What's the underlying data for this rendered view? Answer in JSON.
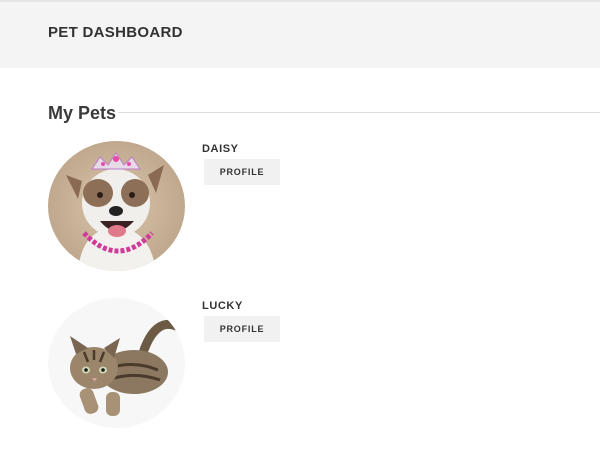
{
  "header": {
    "title": "PET DASHBOARD"
  },
  "section": {
    "title": "My Pets"
  },
  "pets": [
    {
      "name": "DAISY",
      "profile_label": "PROFILE",
      "photo": "dog-with-tiara-photo"
    },
    {
      "name": "LUCKY",
      "profile_label": "PROFILE",
      "photo": "tabby-kitten-photo"
    }
  ],
  "colors": {
    "header_bg": "#f4f4f4",
    "button_bg": "#f1f1f1",
    "divider": "#dcdcdc",
    "text": "#333333"
  }
}
